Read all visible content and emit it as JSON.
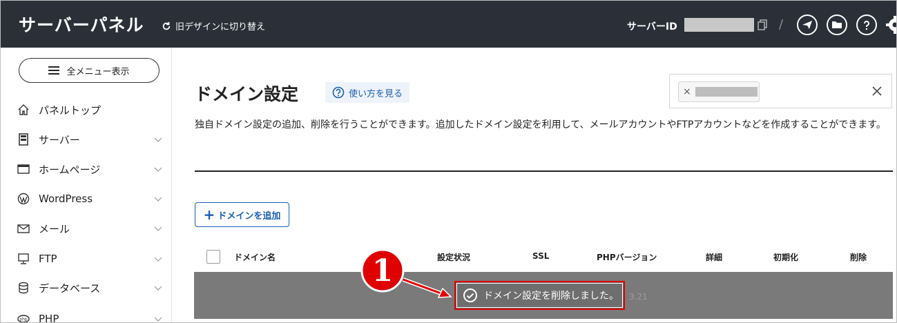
{
  "header": {
    "brand": "サーバーパネル",
    "switch_label": "旧デザインに切り替え",
    "server_id_label": "サーバーID"
  },
  "sidebar": {
    "menu_button": "全メニュー表示",
    "items": [
      {
        "label": "パネルトップ",
        "icon": "home-icon"
      },
      {
        "label": "サーバー",
        "icon": "server-icon"
      },
      {
        "label": "ホームページ",
        "icon": "browser-icon"
      },
      {
        "label": "WordPress",
        "icon": "wordpress-icon"
      },
      {
        "label": "メール",
        "icon": "mail-icon"
      },
      {
        "label": "FTP",
        "icon": "monitor-icon"
      },
      {
        "label": "データベース",
        "icon": "database-icon"
      },
      {
        "label": "PHP",
        "icon": "php-icon"
      }
    ]
  },
  "main": {
    "title": "ドメイン設定",
    "help_link": "使い方を見る",
    "description": "独自ドメイン設定の追加、削除を行うことができます。追加したドメイン設定を利用して、メールアカウントやFTPアカウントなどを作成することができます。",
    "add_button": "ドメインを追加",
    "filter_chip_remove": "×",
    "table": {
      "headers": [
        "ドメイン名",
        "設定状況",
        "SSL",
        "PHPバージョン",
        "詳細",
        "初期化",
        "削除"
      ],
      "row_ghost_php": "3.21"
    },
    "toast": "ドメイン設定を削除しました。",
    "annotation_badge": "1"
  },
  "colors": {
    "header_bg": "#2b3038",
    "accent": "#1a5fb4",
    "highlight": "#e00000",
    "overlay": "#7a7a7a"
  }
}
